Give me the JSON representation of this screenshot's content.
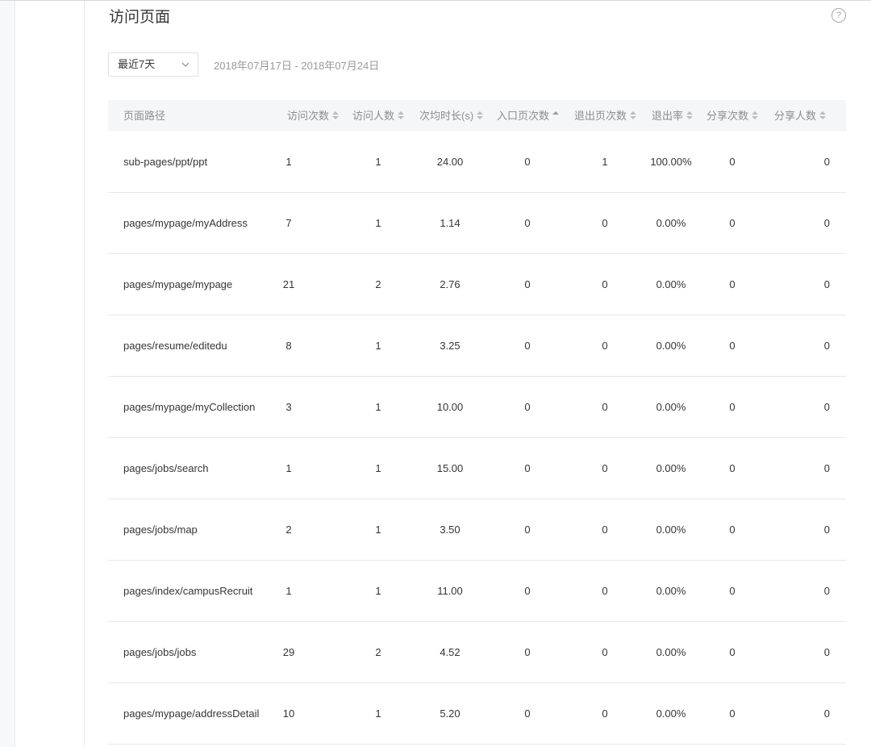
{
  "page": {
    "title": "访问页面",
    "help_icon": "question-circle-icon",
    "help_glyph": "?"
  },
  "filter": {
    "range_selected": "最近7天",
    "date_range": "2018年07月17日 - 2018年07月24日"
  },
  "table": {
    "columns": [
      "页面路径",
      "访问次数",
      "访问人数",
      "次均时长(s)",
      "入口页次数",
      "退出页次数",
      "退出率",
      "分享次数",
      "分享人数"
    ],
    "sorted_column": "入口页次数",
    "rows": [
      {
        "path": "sub-pages/ppt/ppt",
        "visits": "1",
        "visitors": "1",
        "avg_duration": "24.00",
        "entry": "0",
        "exit": "1",
        "exit_rate": "100.00%",
        "shares": "0",
        "sharers": "0"
      },
      {
        "path": "pages/mypage/myAddress",
        "visits": "7",
        "visitors": "1",
        "avg_duration": "1.14",
        "entry": "0",
        "exit": "0",
        "exit_rate": "0.00%",
        "shares": "0",
        "sharers": "0"
      },
      {
        "path": "pages/mypage/mypage",
        "visits": "21",
        "visitors": "2",
        "avg_duration": "2.76",
        "entry": "0",
        "exit": "0",
        "exit_rate": "0.00%",
        "shares": "0",
        "sharers": "0"
      },
      {
        "path": "pages/resume/editedu",
        "visits": "8",
        "visitors": "1",
        "avg_duration": "3.25",
        "entry": "0",
        "exit": "0",
        "exit_rate": "0.00%",
        "shares": "0",
        "sharers": "0"
      },
      {
        "path": "pages/mypage/myCollection",
        "visits": "3",
        "visitors": "1",
        "avg_duration": "10.00",
        "entry": "0",
        "exit": "0",
        "exit_rate": "0.00%",
        "shares": "0",
        "sharers": "0"
      },
      {
        "path": "pages/jobs/search",
        "visits": "1",
        "visitors": "1",
        "avg_duration": "15.00",
        "entry": "0",
        "exit": "0",
        "exit_rate": "0.00%",
        "shares": "0",
        "sharers": "0"
      },
      {
        "path": "pages/jobs/map",
        "visits": "2",
        "visitors": "1",
        "avg_duration": "3.50",
        "entry": "0",
        "exit": "0",
        "exit_rate": "0.00%",
        "shares": "0",
        "sharers": "0"
      },
      {
        "path": "pages/index/campusRecruit",
        "visits": "1",
        "visitors": "1",
        "avg_duration": "11.00",
        "entry": "0",
        "exit": "0",
        "exit_rate": "0.00%",
        "shares": "0",
        "sharers": "0"
      },
      {
        "path": "pages/jobs/jobs",
        "visits": "29",
        "visitors": "2",
        "avg_duration": "4.52",
        "entry": "0",
        "exit": "0",
        "exit_rate": "0.00%",
        "shares": "0",
        "sharers": "0"
      },
      {
        "path": "pages/mypage/addressDetail",
        "visits": "10",
        "visitors": "1",
        "avg_duration": "5.20",
        "entry": "0",
        "exit": "0",
        "exit_rate": "0.00%",
        "shares": "0",
        "sharers": "0"
      }
    ]
  }
}
